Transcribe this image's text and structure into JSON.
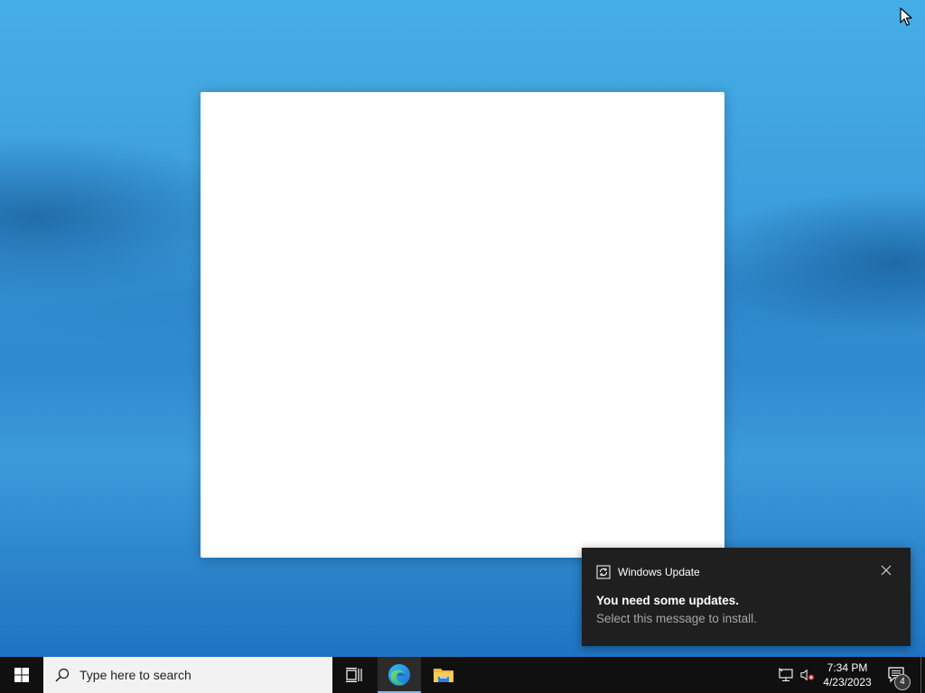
{
  "desktop": {
    "window": {
      "state": "blank"
    }
  },
  "notification": {
    "app_name": "Windows Update",
    "app_icon": "refresh-icon",
    "title": "You need some updates.",
    "body": "Select this message to install.",
    "close_icon": "close-icon"
  },
  "taskbar": {
    "start_icon": "windows-logo-icon",
    "search": {
      "placeholder": "Type here to search",
      "icon": "search-icon"
    },
    "pinned": [
      {
        "name": "Task View",
        "icon": "task-view-icon",
        "active": false
      },
      {
        "name": "Microsoft Edge",
        "icon": "edge-icon",
        "active": true
      },
      {
        "name": "File Explorer",
        "icon": "folder-icon",
        "active": false
      }
    ],
    "tray": {
      "network_icon": "network-icon",
      "volume_icon": "volume-muted-icon",
      "time": "7:34 PM",
      "date": "4/23/2023",
      "notification_count": "4"
    }
  },
  "colors": {
    "taskbar": "#101010",
    "toast_bg": "#1f1f1f",
    "desktop_accent": "#2f89cd",
    "active_indicator": "#76b9ed"
  }
}
